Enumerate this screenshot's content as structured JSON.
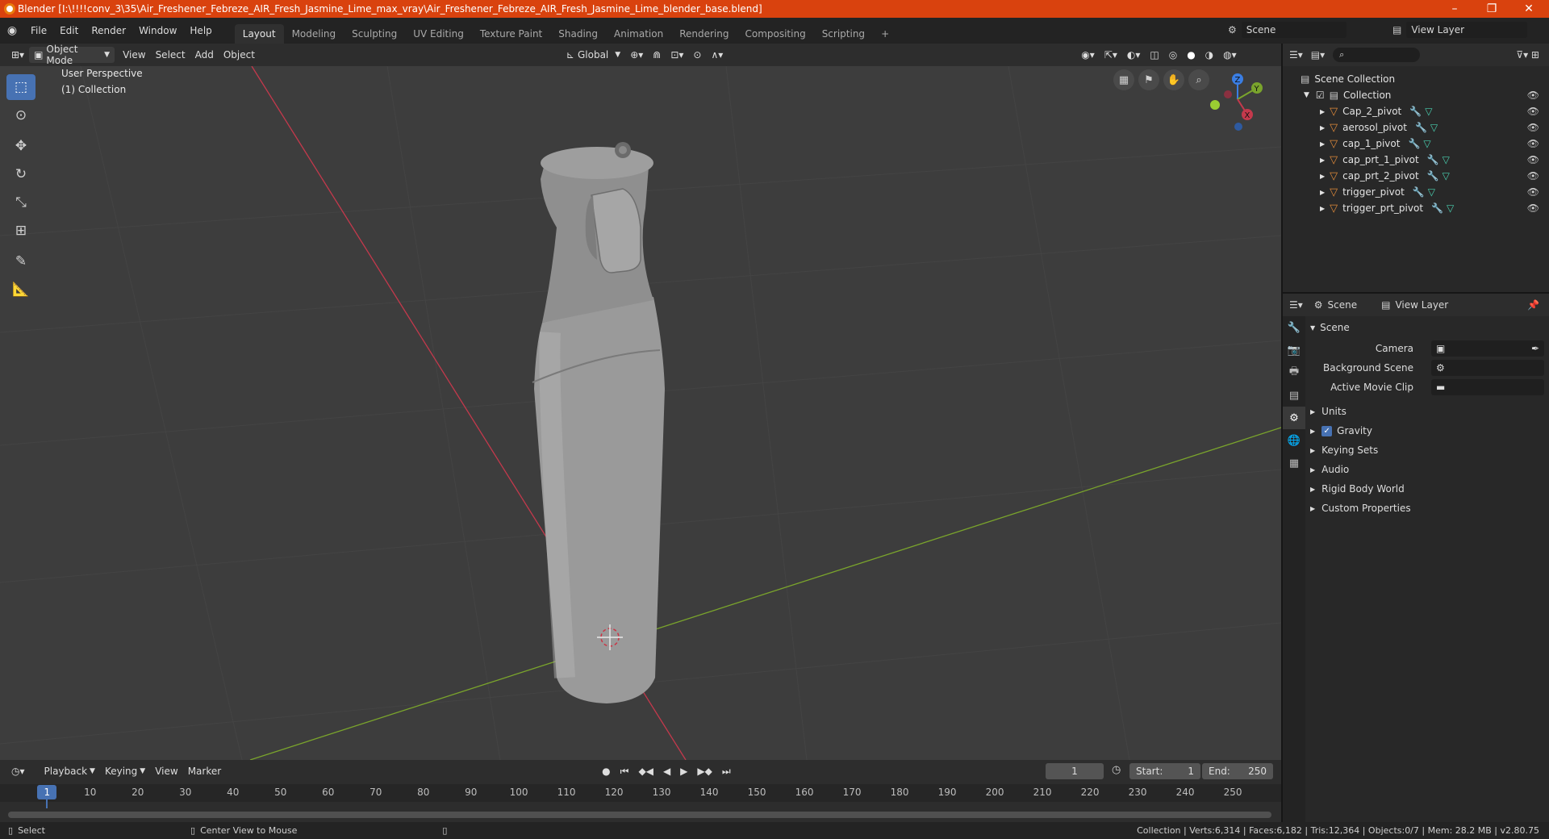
{
  "window": {
    "title": "Blender [I:\\!!!!conv_3\\35\\Air_Freshener_Febreze_AIR_Fresh_Jasmine_Lime_max_vray\\Air_Freshener_Febreze_AIR_Fresh_Jasmine_Lime_blender_base.blend]",
    "minimize": "–",
    "restore": "❐",
    "close": "✕"
  },
  "menu": {
    "items": [
      "File",
      "Edit",
      "Render",
      "Window",
      "Help"
    ]
  },
  "workspaces": {
    "tabs": [
      "Layout",
      "Modeling",
      "Sculpting",
      "UV Editing",
      "Texture Paint",
      "Shading",
      "Animation",
      "Rendering",
      "Compositing",
      "Scripting"
    ],
    "active": "Layout",
    "add": "+"
  },
  "top_right": {
    "scene": "Scene",
    "view_layer": "View Layer"
  },
  "viewport_header": {
    "mode": "Object Mode",
    "menus": [
      "View",
      "Select",
      "Add",
      "Object"
    ],
    "transform_orientation": "Global"
  },
  "viewport": {
    "perspective": "User Perspective",
    "collection": "(1) Collection",
    "gizmo": {
      "x": "X",
      "y": "Y",
      "z": "Z"
    }
  },
  "outliner": {
    "scene_collection": "Scene Collection",
    "collection": "Collection",
    "objects": [
      "Cap_2_pivot",
      "aerosol_pivot",
      "cap_1_pivot",
      "cap_prt_1_pivot",
      "cap_prt_2_pivot",
      "trigger_pivot",
      "trigger_prt_pivot"
    ]
  },
  "properties": {
    "tab_scene": "Scene",
    "tab_view_layer": "View Layer",
    "panel_title": "Scene",
    "camera_label": "Camera",
    "background_scene_label": "Background Scene",
    "active_movie_clip_label": "Active Movie Clip",
    "subpanels": [
      "Units",
      "Gravity",
      "Keying Sets",
      "Audio",
      "Rigid Body World",
      "Custom Properties"
    ],
    "gravity_checked": true
  },
  "timeline": {
    "menus": [
      "Playback",
      "Keying",
      "View",
      "Marker"
    ],
    "current_frame": "1",
    "start_label": "Start:",
    "start": "1",
    "end_label": "End:",
    "end": "250",
    "ticks": [
      "1",
      "10",
      "20",
      "30",
      "40",
      "50",
      "60",
      "70",
      "80",
      "90",
      "100",
      "110",
      "120",
      "130",
      "140",
      "150",
      "160",
      "170",
      "180",
      "190",
      "200",
      "210",
      "220",
      "230",
      "240",
      "250"
    ]
  },
  "statusbar": {
    "select": "Select",
    "center_view": "Center View to Mouse",
    "stats": "Collection | Verts:6,314 | Faces:6,182 | Tris:12,364 | Objects:0/7 | Mem: 28.2 MB | v2.80.75"
  },
  "colors": {
    "title_bar": "#d9420e",
    "active_tool": "#4772b3",
    "x_axis": "#c4394c",
    "y_axis": "#7aa42c",
    "z_axis": "#3a7ee4"
  }
}
